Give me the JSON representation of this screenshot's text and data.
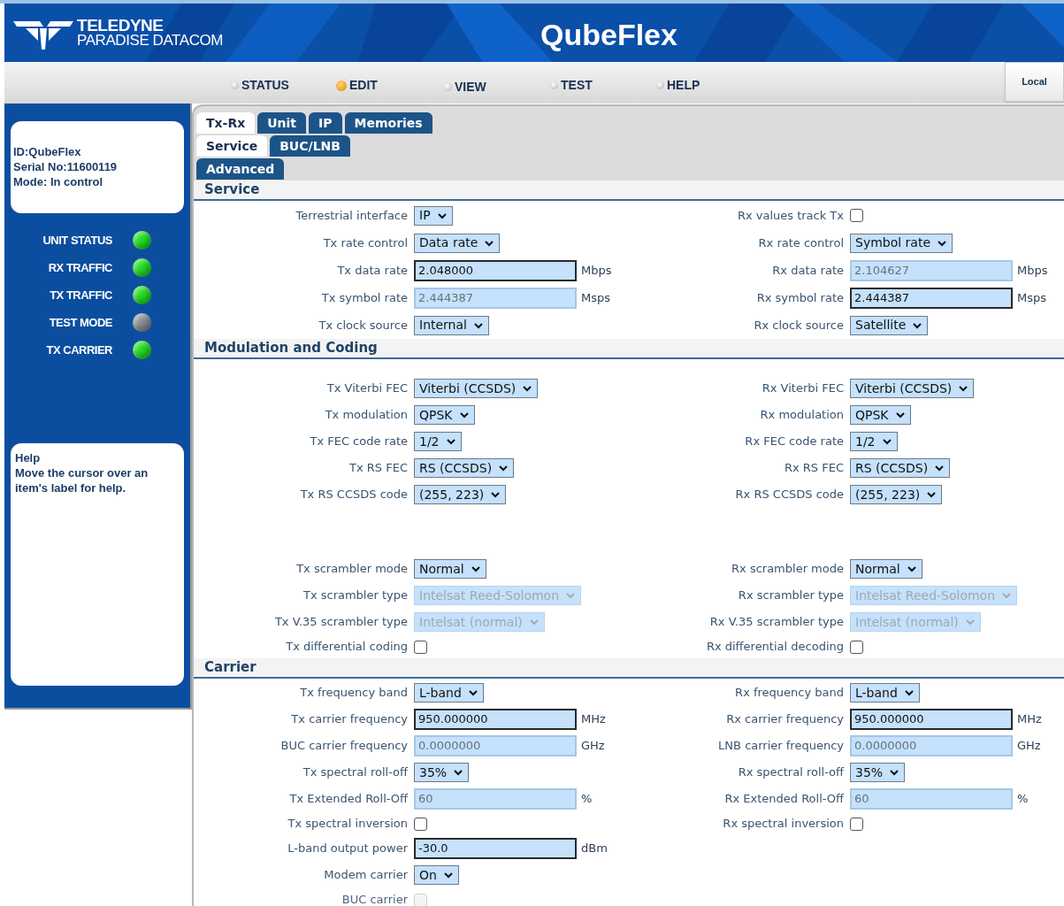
{
  "header": {
    "brand_line1": "TELEDYNE",
    "brand_line2": "PARADISE DATACOM",
    "product": "QubeFlex"
  },
  "nav": [
    {
      "label": "STATUS",
      "selected": false
    },
    {
      "label": "EDIT",
      "selected": true
    },
    {
      "label": "VIEW",
      "selected": false
    },
    {
      "label": "TEST",
      "selected": false
    },
    {
      "label": "HELP",
      "selected": false
    }
  ],
  "local_button": "Local",
  "sidebar": {
    "info": [
      "ID:QubeFlex",
      "Serial No:11600119",
      "Mode: In control"
    ],
    "indicators": [
      {
        "label": "UNIT STATUS",
        "color": "#22dd22"
      },
      {
        "label": "RX TRAFFIC",
        "color": "#22dd22"
      },
      {
        "label": "TX TRAFFIC",
        "color": "#22dd22"
      },
      {
        "label": "TEST MODE",
        "color": "#8a9096"
      },
      {
        "label": "TX CARRIER",
        "color": "#22dd22"
      }
    ],
    "help": {
      "title": "Help",
      "text": "Move the cursor over an item's label for help."
    }
  },
  "tabs": [
    [
      {
        "label": "Tx-Rx",
        "selected": true
      },
      {
        "label": "Unit",
        "selected": false
      },
      {
        "label": "IP",
        "selected": false
      },
      {
        "label": "Memories",
        "selected": false
      }
    ],
    [
      {
        "label": "Service",
        "selected": true
      },
      {
        "label": "BUC/LNB",
        "selected": false
      }
    ],
    [
      {
        "label": "Advanced",
        "selected": false
      }
    ]
  ],
  "sections": [
    {
      "title": "Service",
      "groups": [
        [
          {
            "left": {
              "kind": "select",
              "label": "Terrestrial interface",
              "value": "IP",
              "disabled": false
            },
            "right": {
              "kind": "checkbox",
              "label": "Rx values track Tx",
              "checked": false,
              "disabled": false
            }
          },
          {
            "left": {
              "kind": "select",
              "label": "Tx rate control",
              "value": "Data rate",
              "disabled": false
            },
            "right": {
              "kind": "select",
              "label": "Rx rate control",
              "value": "Symbol rate",
              "disabled": false
            }
          },
          {
            "left": {
              "kind": "text",
              "label": "Tx data rate",
              "value": "2.048000",
              "unit": "Mbps",
              "disabled": false
            },
            "right": {
              "kind": "text",
              "label": "Rx data rate",
              "value": "2.104627",
              "unit": "Mbps",
              "disabled": true
            }
          },
          {
            "left": {
              "kind": "text",
              "label": "Tx symbol rate",
              "value": "2.444387",
              "unit": "Msps",
              "disabled": true
            },
            "right": {
              "kind": "text",
              "label": "Rx symbol rate",
              "value": "2.444387",
              "unit": "Msps",
              "disabled": false
            }
          },
          {
            "left": {
              "kind": "select",
              "label": "Tx clock source",
              "value": "Internal",
              "disabled": false
            },
            "right": {
              "kind": "select",
              "label": "Rx clock source",
              "value": "Satellite",
              "disabled": false
            }
          }
        ]
      ]
    },
    {
      "title": "Modulation and Coding",
      "groups": [
        [
          {
            "left": {
              "kind": "select",
              "label": "Tx Viterbi FEC",
              "value": "Viterbi (CCSDS)",
              "disabled": false
            },
            "right": {
              "kind": "select",
              "label": "Rx Viterbi FEC",
              "value": "Viterbi (CCSDS)",
              "disabled": false
            }
          },
          {
            "left": {
              "kind": "select",
              "label": "Tx modulation",
              "value": "QPSK",
              "disabled": false
            },
            "right": {
              "kind": "select",
              "label": "Rx modulation",
              "value": "QPSK",
              "disabled": false
            }
          },
          {
            "left": {
              "kind": "select",
              "label": "Tx FEC code rate",
              "value": "1/2",
              "disabled": false
            },
            "right": {
              "kind": "select",
              "label": "Rx FEC code rate",
              "value": "1/2",
              "disabled": false
            }
          },
          {
            "left": {
              "kind": "select",
              "label": "Tx RS FEC",
              "value": "RS (CCSDS)",
              "disabled": false
            },
            "right": {
              "kind": "select",
              "label": "Rx RS FEC",
              "value": "RS (CCSDS)",
              "disabled": false
            }
          },
          {
            "left": {
              "kind": "select",
              "label": "Tx RS CCSDS code",
              "value": "(255, 223)",
              "disabled": false
            },
            "right": {
              "kind": "select",
              "label": "Rx RS CCSDS code",
              "value": "(255, 223)",
              "disabled": false
            }
          }
        ],
        [
          {
            "left": {
              "kind": "select",
              "label": "Tx scrambler mode",
              "value": "Normal",
              "disabled": false
            },
            "right": {
              "kind": "select",
              "label": "Rx scrambler mode",
              "value": "Normal",
              "disabled": false
            }
          },
          {
            "left": {
              "kind": "select",
              "label": "Tx scrambler type",
              "value": "Intelsat Reed-Solomon",
              "disabled": true
            },
            "right": {
              "kind": "select",
              "label": "Rx scrambler type",
              "value": "Intelsat Reed-Solomon",
              "disabled": true
            }
          },
          {
            "left": {
              "kind": "select",
              "label": "Tx V.35 scrambler type",
              "value": "Intelsat (normal)",
              "disabled": true
            },
            "right": {
              "kind": "select",
              "label": "Rx V.35 scrambler type",
              "value": "Intelsat (normal)",
              "disabled": true
            }
          },
          {
            "left": {
              "kind": "checkbox",
              "label": "Tx differential coding",
              "checked": false,
              "disabled": false
            },
            "right": {
              "kind": "checkbox",
              "label": "Rx differential decoding",
              "checked": false,
              "disabled": false
            }
          }
        ]
      ]
    },
    {
      "title": "Carrier",
      "groups": [
        [
          {
            "left": {
              "kind": "select",
              "label": "Tx frequency band",
              "value": "L-band",
              "disabled": false
            },
            "right": {
              "kind": "select",
              "label": "Rx frequency band",
              "value": "L-band",
              "disabled": false
            }
          },
          {
            "left": {
              "kind": "text",
              "label": "Tx carrier frequency",
              "value": "950.000000",
              "unit": "MHz",
              "disabled": false
            },
            "right": {
              "kind": "text",
              "label": "Rx carrier frequency",
              "value": "950.000000",
              "unit": "MHz",
              "disabled": false
            }
          },
          {
            "left": {
              "kind": "text",
              "label": "BUC carrier frequency",
              "value": "0.0000000",
              "unit": "GHz",
              "disabled": true
            },
            "right": {
              "kind": "text",
              "label": "LNB carrier frequency",
              "value": "0.0000000",
              "unit": "GHz",
              "disabled": true
            }
          },
          {
            "left": {
              "kind": "select",
              "label": "Tx spectral roll-off",
              "value": "35%",
              "disabled": false
            },
            "right": {
              "kind": "select",
              "label": "Rx spectral roll-off",
              "value": "35%",
              "disabled": false
            }
          },
          {
            "left": {
              "kind": "text",
              "label": "Tx Extended Roll-Off",
              "value": "60",
              "unit": "%",
              "disabled": true
            },
            "right": {
              "kind": "text",
              "label": "Rx Extended Roll-Off",
              "value": "60",
              "unit": "%",
              "disabled": true
            }
          },
          {
            "left": {
              "kind": "checkbox",
              "label": "Tx spectral inversion",
              "checked": false,
              "disabled": false
            },
            "right": {
              "kind": "checkbox",
              "label": "Rx spectral inversion",
              "checked": false,
              "disabled": false
            }
          },
          {
            "left": {
              "kind": "text",
              "label": "L-band output power",
              "value": "-30.0",
              "unit": "dBm",
              "disabled": false
            }
          },
          {
            "left": {
              "kind": "select",
              "label": "Modem carrier",
              "value": "On",
              "disabled": false
            }
          },
          {
            "left": {
              "kind": "checkbox",
              "label": "BUC carrier",
              "checked": false,
              "disabled": true
            }
          }
        ]
      ]
    }
  ]
}
